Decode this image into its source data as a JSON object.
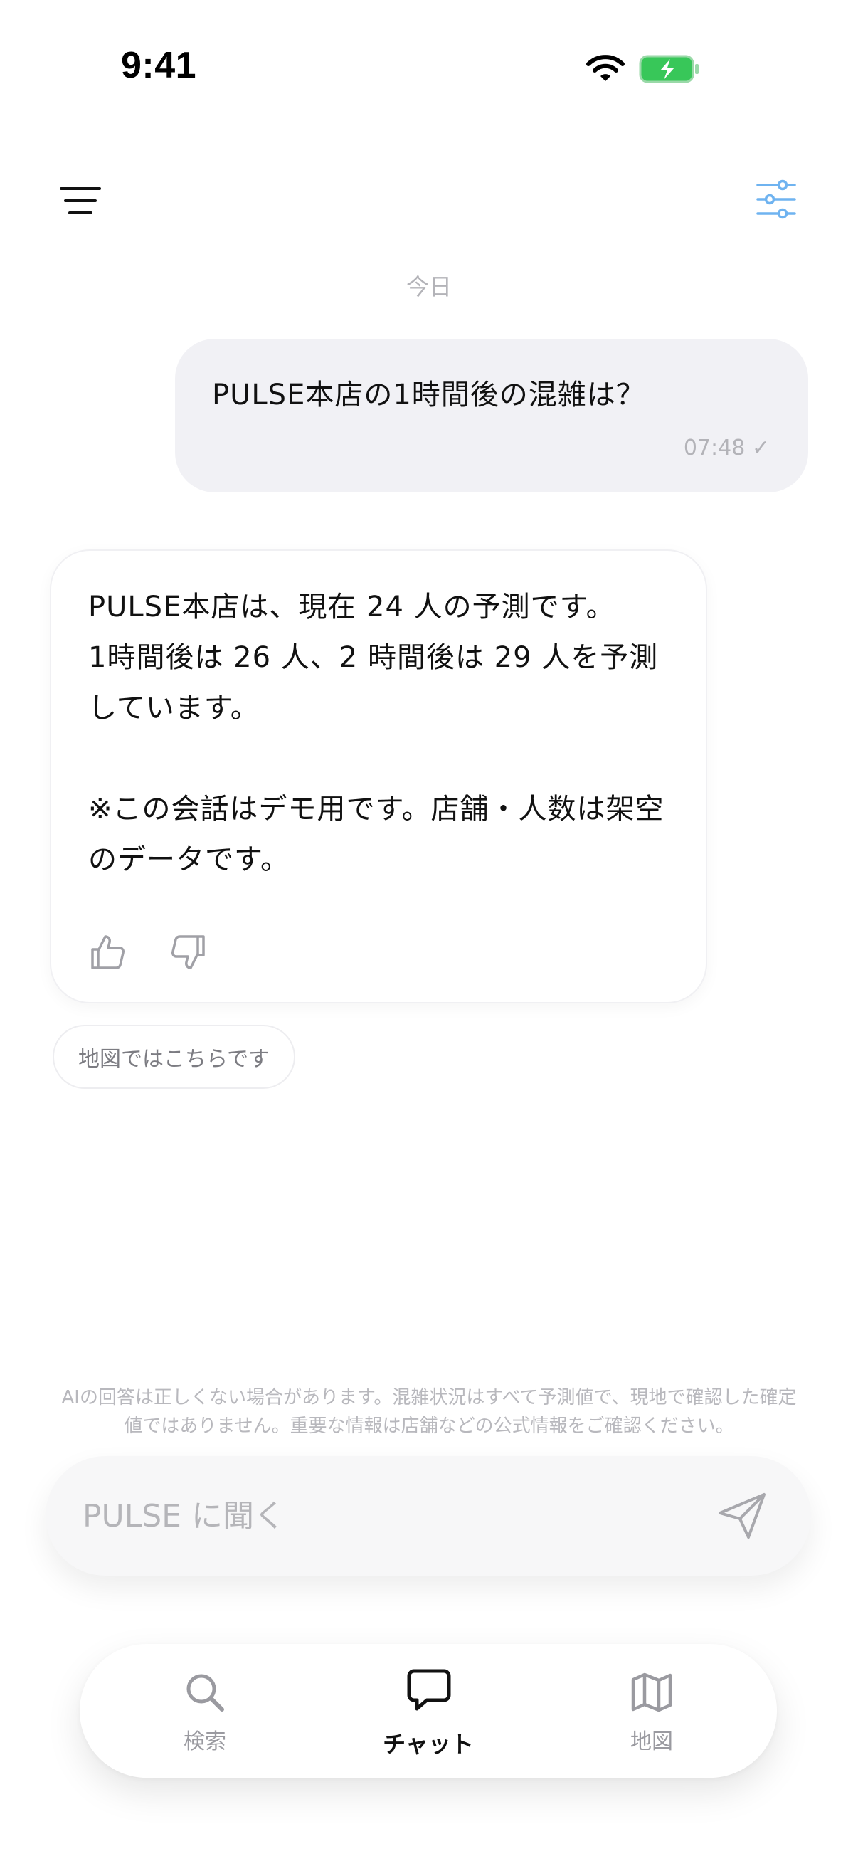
{
  "status_bar": {
    "time": "9:41"
  },
  "chat": {
    "date_separator": "今日",
    "user_message": {
      "text": "PULSE本店の1時間後の混雑は？",
      "time": "07:48",
      "read_mark": "✓"
    },
    "ai_message": {
      "line1": "PULSE本店は、現在 24 人の予測です。",
      "line2": "1時間後は 26 人、2 時間後は 29 人を予測しています。",
      "line3": "※この会話はデモ用です。店舗・人数は架空のデータです。"
    },
    "suggestion": "地図ではこちらです"
  },
  "disclaimer": "AIの回答は正しくない場合があります。混雑状況はすべて予測値で、現地で確認した確定値ではありません。重要な情報は店舗などの公式情報をご確認ください。",
  "input": {
    "placeholder": "PULSE に聞く",
    "value": ""
  },
  "tabs": [
    {
      "label": "検索",
      "icon": "search-icon",
      "active": false
    },
    {
      "label": "チャット",
      "icon": "chat-bubble-icon",
      "active": true
    },
    {
      "label": "地図",
      "icon": "map-icon",
      "active": false
    }
  ],
  "colors": {
    "accent": "#6fb3f0",
    "battery": "#38c759",
    "bubble": "#f1f1f5",
    "muted_text": "#b3b3b8"
  }
}
